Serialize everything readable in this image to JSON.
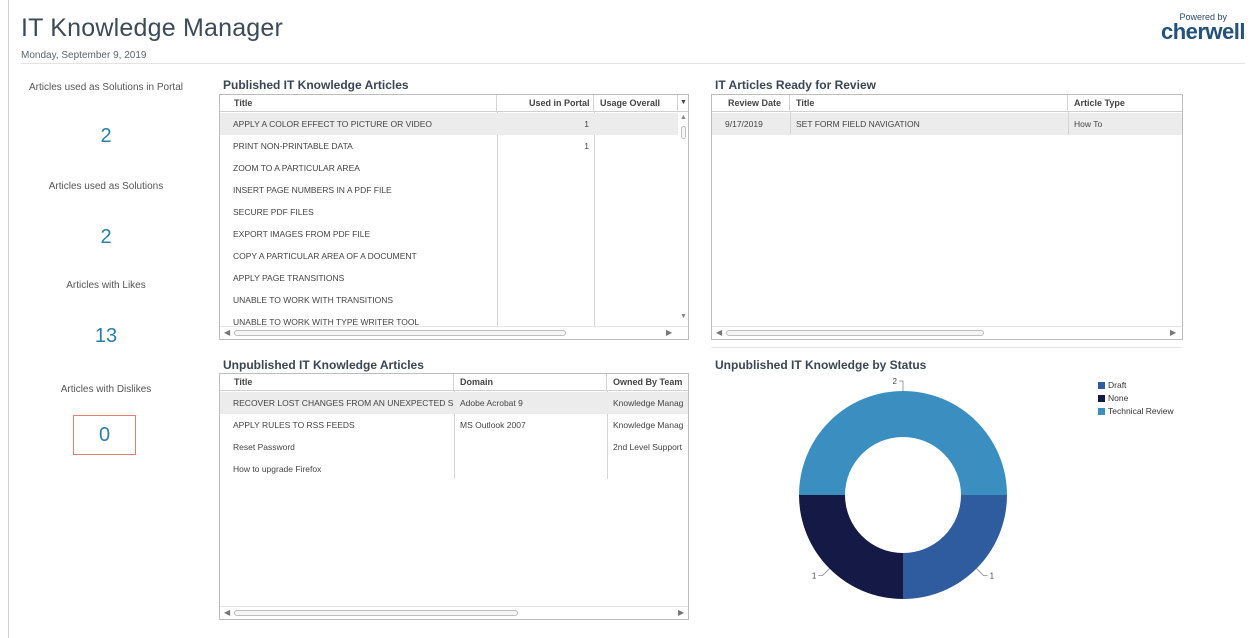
{
  "header": {
    "title": "IT Knowledge Manager",
    "date": "Monday, September 9, 2019",
    "powered_by": "Powered by",
    "brand": "cherwell"
  },
  "kpis": [
    {
      "label": "Articles used as Solutions in Portal",
      "value": "2"
    },
    {
      "label": "Articles used as Solutions",
      "value": "2"
    },
    {
      "label": "Articles with Likes",
      "value": "13"
    },
    {
      "label": "Articles with Dislikes",
      "value": "0"
    }
  ],
  "published": {
    "title": "Published IT Knowledge Articles",
    "columns": [
      "Title",
      "Used in Portal",
      "Usage Overall"
    ],
    "rows": [
      {
        "title": "APPLY A COLOR EFFECT TO PICTURE OR VIDEO",
        "used": "1",
        "usage": ""
      },
      {
        "title": "PRINT NON-PRINTABLE DATA",
        "used": "1",
        "usage": ""
      },
      {
        "title": "ZOOM TO A PARTICULAR AREA",
        "used": "",
        "usage": ""
      },
      {
        "title": "INSERT PAGE NUMBERS IN A PDF FILE",
        "used": "",
        "usage": ""
      },
      {
        "title": "SECURE PDF FILES",
        "used": "",
        "usage": ""
      },
      {
        "title": "EXPORT IMAGES FROM PDF FILE",
        "used": "",
        "usage": ""
      },
      {
        "title": "COPY A PARTICULAR AREA OF A DOCUMENT",
        "used": "",
        "usage": ""
      },
      {
        "title": "APPLY PAGE TRANSITIONS",
        "used": "",
        "usage": ""
      },
      {
        "title": "UNABLE TO WORK WITH TRANSITIONS",
        "used": "",
        "usage": ""
      },
      {
        "title": "UNABLE TO WORK WITH TYPE WRITER TOOL",
        "used": "",
        "usage": ""
      }
    ]
  },
  "review": {
    "title": "IT Articles Ready for Review",
    "columns": [
      "Review Date",
      "Title",
      "Article Type"
    ],
    "rows": [
      {
        "date": "9/17/2019",
        "title": "SET FORM FIELD NAVIGATION",
        "type": "How To"
      }
    ]
  },
  "unpublished": {
    "title": "Unpublished IT Knowledge Articles",
    "columns": [
      "Title",
      "Domain",
      "Owned By Team"
    ],
    "rows": [
      {
        "title": "RECOVER LOST CHANGES FROM AN UNEXPECTED S",
        "domain": "Adobe Acrobat 9",
        "team": "Knowledge Manag"
      },
      {
        "title": "APPLY RULES TO RSS FEEDS",
        "domain": "MS Outlook 2007",
        "team": "Knowledge Manag"
      },
      {
        "title": "Reset Password",
        "domain": "",
        "team": "2nd Level Support"
      },
      {
        "title": "How to upgrade Firefox",
        "domain": "",
        "team": ""
      }
    ]
  },
  "status_chart": {
    "title": "Unpublished IT Knowledge by Status"
  },
  "chart_data": {
    "type": "pie",
    "donut": true,
    "categories": [
      "Draft",
      "None",
      "Technical Review"
    ],
    "values": [
      1,
      1,
      2
    ],
    "data_labels": [
      "1",
      "1",
      "2"
    ],
    "colors": [
      "#2e5c9e",
      "#141a45",
      "#3b8fc0"
    ],
    "legend": "right"
  }
}
